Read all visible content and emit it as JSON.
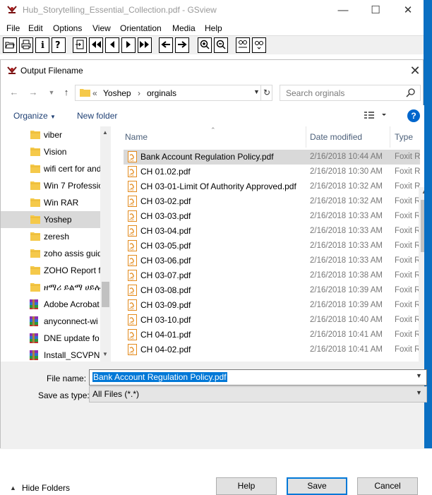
{
  "main_window": {
    "title": "Hub_Storytelling_Essential_Collection.pdf - GSview",
    "minimize_glyph": "—",
    "maximize_glyph": "☐",
    "close_glyph": "✕",
    "menu": [
      "File",
      "Edit",
      "Options",
      "View",
      "Orientation",
      "Media",
      "Help"
    ]
  },
  "dialog": {
    "title": "Output Filename",
    "close_glyph": "✕",
    "breadcrumb": {
      "overflow": "«",
      "folder": "Yoshep",
      "separator": "›",
      "current": "orginals"
    },
    "search_placeholder": "Search orginals",
    "organize_label": "Organize",
    "new_folder_label": "New folder",
    "help_glyph": "?",
    "sidebar": [
      {
        "label": "viber",
        "icon": "folder-icon",
        "selected": false
      },
      {
        "label": "Vision",
        "icon": "folder-icon",
        "selected": false
      },
      {
        "label": "wifi cert for and",
        "icon": "folder-icon",
        "selected": false
      },
      {
        "label": "Win 7 Professic",
        "icon": "folder-icon",
        "selected": false
      },
      {
        "label": "Win RAR",
        "icon": "folder-icon",
        "selected": false
      },
      {
        "label": "Yoshep",
        "icon": "folder-icon",
        "selected": true
      },
      {
        "label": "zeresh",
        "icon": "folder-icon",
        "selected": false
      },
      {
        "label": "zoho assis guid",
        "icon": "folder-icon",
        "selected": false
      },
      {
        "label": "ZOHO Report f",
        "icon": "folder-icon",
        "selected": false
      },
      {
        "label": "ዘማሪ ይልማ ሀይሉ",
        "icon": "folder-icon",
        "selected": false
      },
      {
        "label": "Adobe Acrobat",
        "icon": "winrar-icon",
        "selected": false
      },
      {
        "label": "anyconnect-wi",
        "icon": "winrar-icon",
        "selected": false
      },
      {
        "label": "DNE update fo",
        "icon": "winrar-icon",
        "selected": false
      },
      {
        "label": "Install_SCVPNL",
        "icon": "winrar-icon",
        "selected": false
      }
    ],
    "columns": {
      "name": "Name",
      "date": "Date modified",
      "type": "Type"
    },
    "files": [
      {
        "name": "Bank Account Regulation Policy.pdf",
        "date": "2/16/2018 10:44 AM",
        "type": "Foxit R",
        "selected": true
      },
      {
        "name": "CH 01.02.pdf",
        "date": "2/16/2018 10:30 AM",
        "type": "Foxit R",
        "selected": false
      },
      {
        "name": "CH 03-01-Limit Of Authority Approved.pdf",
        "date": "2/16/2018 10:32 AM",
        "type": "Foxit R",
        "selected": false
      },
      {
        "name": "CH 03-02.pdf",
        "date": "2/16/2018 10:32 AM",
        "type": "Foxit R",
        "selected": false
      },
      {
        "name": "CH 03-03.pdf",
        "date": "2/16/2018 10:33 AM",
        "type": "Foxit R",
        "selected": false
      },
      {
        "name": "CH 03-04.pdf",
        "date": "2/16/2018 10:33 AM",
        "type": "Foxit R",
        "selected": false
      },
      {
        "name": "CH 03-05.pdf",
        "date": "2/16/2018 10:33 AM",
        "type": "Foxit R",
        "selected": false
      },
      {
        "name": "CH 03-06.pdf",
        "date": "2/16/2018 10:33 AM",
        "type": "Foxit R",
        "selected": false
      },
      {
        "name": "CH 03-07.pdf",
        "date": "2/16/2018 10:38 AM",
        "type": "Foxit R",
        "selected": false
      },
      {
        "name": "CH 03-08.pdf",
        "date": "2/16/2018 10:39 AM",
        "type": "Foxit R",
        "selected": false
      },
      {
        "name": "CH 03-09.pdf",
        "date": "2/16/2018 10:39 AM",
        "type": "Foxit R",
        "selected": false
      },
      {
        "name": "CH 03-10.pdf",
        "date": "2/16/2018 10:40 AM",
        "type": "Foxit R",
        "selected": false
      },
      {
        "name": "CH 04-01.pdf",
        "date": "2/16/2018 10:41 AM",
        "type": "Foxit R",
        "selected": false
      },
      {
        "name": "CH 04-02.pdf",
        "date": "2/16/2018 10:41 AM",
        "type": "Foxit R",
        "selected": false
      }
    ],
    "file_name_label": "File name:",
    "file_name_value": "Bank Account Regulation Policy.pdf",
    "save_as_type_label": "Save as type:",
    "save_as_type_value": "All Files (*.*)",
    "hide_folders_label": "Hide Folders",
    "help_button": "Help",
    "save_button": "Save",
    "cancel_button": "Cancel"
  },
  "colors": {
    "accent": "#0078d7",
    "selection": "#d9d9d9",
    "folder": "#f5c94a",
    "pdf": "#e38a1c",
    "taskbar_edge": "#0a6fc2"
  }
}
